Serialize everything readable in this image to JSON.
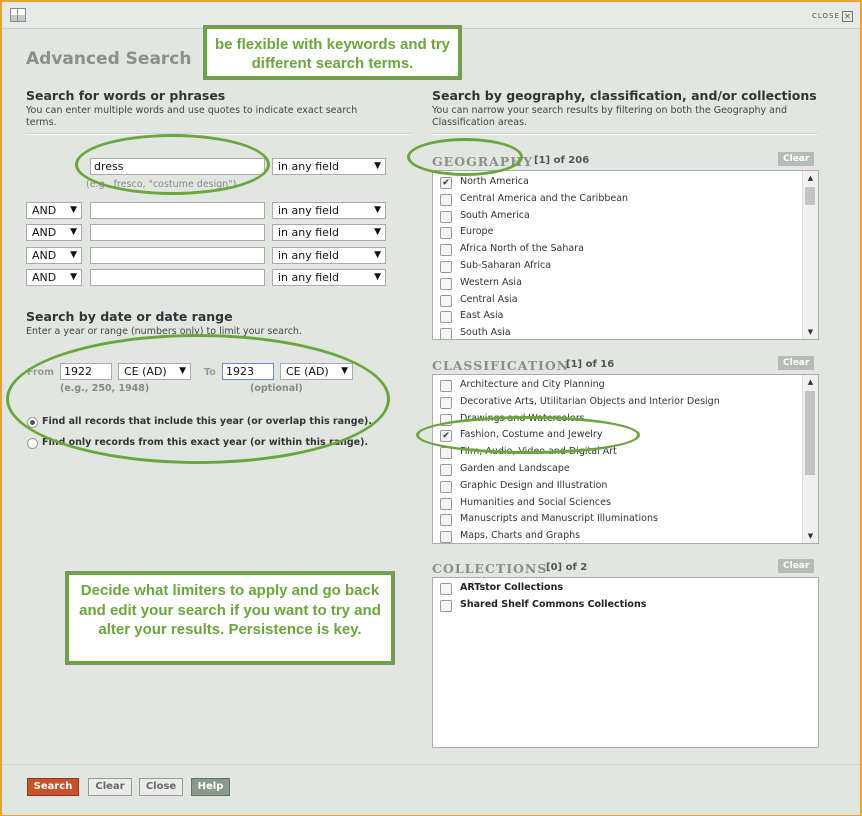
{
  "window": {
    "close_label": "CLOSE",
    "close_glyph": "✕"
  },
  "title": "Advanced Search",
  "words": {
    "heading": "Search for words or phrases",
    "desc": "You can enter multiple words and use quotes to indicate exact search terms.",
    "first_value": "dress",
    "first_field": "in any field",
    "example": "(e.g., fresco, \"costume design\")",
    "rows": [
      {
        "op": "AND",
        "value": "",
        "field": "in any field"
      },
      {
        "op": "AND",
        "value": "",
        "field": "in any field"
      },
      {
        "op": "AND",
        "value": "",
        "field": "in any field"
      },
      {
        "op": "AND",
        "value": "",
        "field": "in any field"
      }
    ]
  },
  "dates": {
    "heading": "Search by date or date range",
    "desc": "Enter a year or range (numbers only) to limit your search.",
    "from_label": "From",
    "from_value": "1922",
    "from_era": "CE (AD)",
    "to_label": "To",
    "to_value": "1923",
    "to_era": "CE (AD)",
    "from_hint": "(e.g., 250, 1948)",
    "to_hint": "(optional)",
    "options": [
      {
        "label": "Find all records that include this year (or overlap this range).",
        "selected": true
      },
      {
        "label": "Find only records from this exact year (or within this range).",
        "selected": false
      }
    ]
  },
  "right": {
    "heading": "Search by geography, classification, and/or collections",
    "desc": "You can narrow your search results by filtering on both the Geography and Classification areas."
  },
  "geography": {
    "label": "Geography",
    "count": "[1] of 206",
    "clear": "Clear",
    "items": [
      {
        "label": "North America",
        "checked": true
      },
      {
        "label": "Central America and the Caribbean",
        "checked": false
      },
      {
        "label": "South America",
        "checked": false
      },
      {
        "label": "Europe",
        "checked": false
      },
      {
        "label": "Africa North of the Sahara",
        "checked": false
      },
      {
        "label": "Sub-Saharan Africa",
        "checked": false
      },
      {
        "label": "Western Asia",
        "checked": false
      },
      {
        "label": "Central Asia",
        "checked": false
      },
      {
        "label": "East Asia",
        "checked": false
      },
      {
        "label": "South Asia",
        "checked": false
      }
    ]
  },
  "classification": {
    "label": "Classification",
    "count": "[1] of 16",
    "clear": "Clear",
    "items": [
      {
        "label": "Architecture and City Planning",
        "checked": false
      },
      {
        "label": "Decorative Arts, Utilitarian Objects and Interior Design",
        "checked": false
      },
      {
        "label": "Drawings and Watercolors",
        "checked": false
      },
      {
        "label": "Fashion, Costume and Jewelry",
        "checked": true
      },
      {
        "label": "Film, Audio, Video and Digital Art",
        "checked": false
      },
      {
        "label": "Garden and Landscape",
        "checked": false
      },
      {
        "label": "Graphic Design and Illustration",
        "checked": false
      },
      {
        "label": "Humanities and Social Sciences",
        "checked": false
      },
      {
        "label": "Manuscripts and Manuscript Illuminations",
        "checked": false
      },
      {
        "label": "Maps, Charts and Graphs",
        "checked": false
      }
    ]
  },
  "collections": {
    "label": "Collections",
    "count": "[0] of 2",
    "clear": "Clear",
    "items": [
      {
        "label": "ARTstor Collections",
        "checked": false
      },
      {
        "label": "Shared Shelf Commons Collections",
        "checked": false
      }
    ]
  },
  "callouts": {
    "top": "be flexible with keywords and try different search terms.",
    "bottom": "Decide what limiters to apply and go back and edit your search if you want to try and alter your results. Persistence is key."
  },
  "footer": {
    "search": "Search",
    "clear": "Clear",
    "close": "Close",
    "help": "Help"
  },
  "colors": {
    "frame": "#f0a030",
    "callout_green": "#6aa63c",
    "search_button": "#c8522a",
    "background": "#e1e6e1"
  },
  "glyphs": {
    "dropdown": "▼",
    "scroll_up": "▲",
    "scroll_down": "▼",
    "check": "✔"
  }
}
